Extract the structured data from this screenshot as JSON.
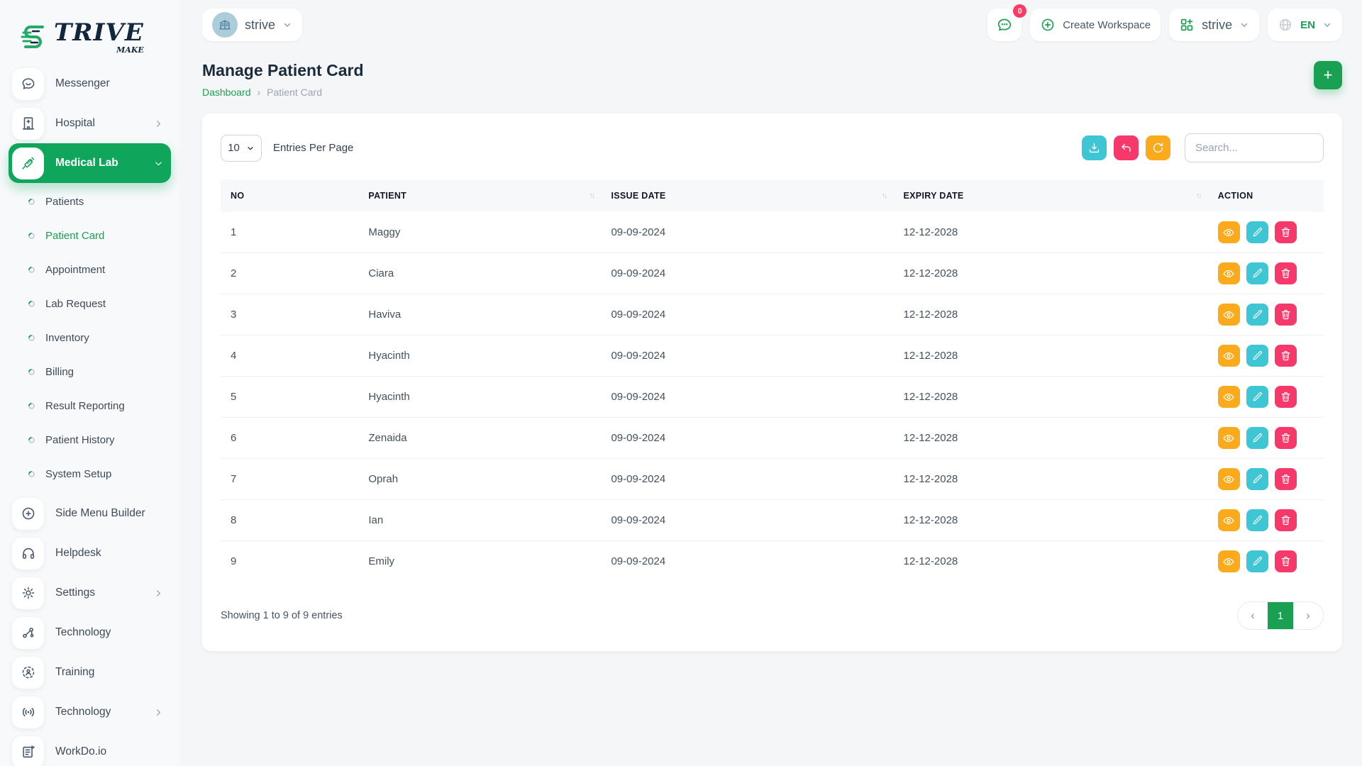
{
  "brand": {
    "name_prefix": "S",
    "name_rest": "TRIVE",
    "tagline": "MAKE"
  },
  "topbar": {
    "workspace_name": "strive",
    "notifications_badge": "0",
    "create_workspace": "Create Workspace",
    "app_name": "strive",
    "language": "EN"
  },
  "page": {
    "title": "Manage Patient Card",
    "breadcrumb_home": "Dashboard",
    "breadcrumb_sep": "›",
    "breadcrumb_current": "Patient Card",
    "add_label": "+"
  },
  "sidebar": {
    "items": [
      {
        "id": "messenger",
        "label": "Messenger",
        "icon": "messenger-icon"
      },
      {
        "id": "hospital",
        "label": "Hospital",
        "icon": "hospital-icon",
        "chevron": "right"
      },
      {
        "id": "medical-lab",
        "label": "Medical Lab",
        "icon": "syringe-icon",
        "chevron": "down",
        "active": true,
        "children": [
          {
            "id": "patients",
            "label": "Patients"
          },
          {
            "id": "patient-card",
            "label": "Patient Card",
            "active": true
          },
          {
            "id": "appointment",
            "label": "Appointment"
          },
          {
            "id": "lab-request",
            "label": "Lab Request"
          },
          {
            "id": "inventory",
            "label": "Inventory"
          },
          {
            "id": "billing",
            "label": "Billing"
          },
          {
            "id": "result-reporting",
            "label": "Result Reporting"
          },
          {
            "id": "patient-history",
            "label": "Patient History"
          },
          {
            "id": "system-setup",
            "label": "System Setup"
          }
        ]
      },
      {
        "id": "side-menu-builder",
        "label": "Side Menu Builder",
        "icon": "plus-circle-icon"
      },
      {
        "id": "helpdesk",
        "label": "Helpdesk",
        "icon": "headset-icon"
      },
      {
        "id": "settings",
        "label": "Settings",
        "icon": "gear-icon",
        "chevron": "right"
      },
      {
        "id": "technology",
        "label": "Technology",
        "icon": "hub-icon"
      },
      {
        "id": "training",
        "label": "Training",
        "icon": "training-icon"
      },
      {
        "id": "technology-2",
        "label": "Technology",
        "icon": "broadcast-icon",
        "chevron": "right"
      },
      {
        "id": "workdo-io",
        "label": "WorkDo.io",
        "icon": "notebook-icon"
      }
    ]
  },
  "toolbar": {
    "entries_value": "10",
    "entries_label": "Entries Per Page",
    "search_placeholder": "Search...",
    "buttons": [
      {
        "id": "download",
        "icon": "download-icon",
        "color": "#3fc6d4"
      },
      {
        "id": "undo",
        "icon": "undo-icon",
        "color": "#f6386a"
      },
      {
        "id": "refresh",
        "icon": "refresh-icon",
        "color": "#fbaa1c"
      }
    ]
  },
  "table": {
    "columns": [
      {
        "key": "no",
        "label": "NO",
        "sortable": false
      },
      {
        "key": "patient",
        "label": "PATIENT",
        "sortable": true
      },
      {
        "key": "issue_date",
        "label": "ISSUE DATE",
        "sortable": true
      },
      {
        "key": "expiry_date",
        "label": "EXPIRY DATE",
        "sortable": true
      },
      {
        "key": "action",
        "label": "ACTION",
        "sortable": false
      }
    ],
    "sort_glyph": "↑↓",
    "rows": [
      {
        "no": "1",
        "patient": "Maggy",
        "issue_date": "09-09-2024",
        "expiry_date": "12-12-2028"
      },
      {
        "no": "2",
        "patient": "Ciara",
        "issue_date": "09-09-2024",
        "expiry_date": "12-12-2028"
      },
      {
        "no": "3",
        "patient": "Haviva",
        "issue_date": "09-09-2024",
        "expiry_date": "12-12-2028"
      },
      {
        "no": "4",
        "patient": "Hyacinth",
        "issue_date": "09-09-2024",
        "expiry_date": "12-12-2028"
      },
      {
        "no": "5",
        "patient": "Hyacinth",
        "issue_date": "09-09-2024",
        "expiry_date": "12-12-2028"
      },
      {
        "no": "6",
        "patient": "Zenaida",
        "issue_date": "09-09-2024",
        "expiry_date": "12-12-2028"
      },
      {
        "no": "7",
        "patient": "Oprah",
        "issue_date": "09-09-2024",
        "expiry_date": "12-12-2028"
      },
      {
        "no": "8",
        "patient": "Ian",
        "issue_date": "09-09-2024",
        "expiry_date": "12-12-2028"
      },
      {
        "no": "9",
        "patient": "Emily",
        "issue_date": "09-09-2024",
        "expiry_date": "12-12-2028"
      }
    ],
    "row_actions": [
      {
        "id": "view",
        "icon": "eye-icon",
        "color": "#fbaa1c"
      },
      {
        "id": "edit",
        "icon": "pencil-icon",
        "color": "#3fc6d4"
      },
      {
        "id": "delete",
        "icon": "trash-icon",
        "color": "#f6386a"
      }
    ]
  },
  "footer": {
    "summary": "Showing 1 to 9 of 9 entries",
    "pagination": {
      "prev": "‹",
      "current": "1",
      "next": "›"
    }
  },
  "colors": {
    "primary": "#1aa053",
    "active_menu": "#0fa65c",
    "info": "#3fc6d4",
    "danger": "#f6386a",
    "warning": "#fbaa1c",
    "badge": "#fb3b64",
    "logo_green": "#21ab67",
    "logo_navy": "#12263c"
  }
}
